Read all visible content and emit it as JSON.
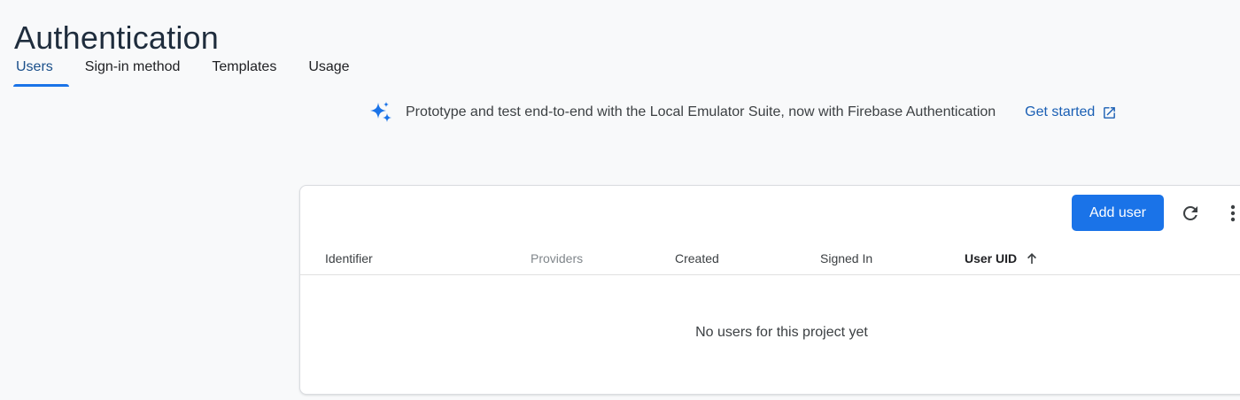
{
  "header": {
    "title": "Authentication"
  },
  "tabs": [
    {
      "label": "Users",
      "active": true
    },
    {
      "label": "Sign-in method",
      "active": false
    },
    {
      "label": "Templates",
      "active": false
    },
    {
      "label": "Usage",
      "active": false
    }
  ],
  "banner": {
    "icon": "sparkle-icon",
    "text": "Prototype and test end-to-end with the Local Emulator Suite, now with Firebase Authentication",
    "link_label": "Get started",
    "link_icon": "open-in-new-icon"
  },
  "users_table": {
    "add_user_label": "Add user",
    "refresh_icon": "refresh-icon",
    "more_icon": "more-vert-icon",
    "columns": [
      {
        "label": "Identifier",
        "style": "normal"
      },
      {
        "label": "Providers",
        "style": "muted"
      },
      {
        "label": "Created",
        "style": "normal"
      },
      {
        "label": "Signed In",
        "style": "normal"
      },
      {
        "label": "User UID",
        "style": "sorted",
        "sort": "ascending"
      }
    ],
    "empty_message": "No users for this project yet"
  },
  "colors": {
    "accent": "#1a73e8",
    "link": "#1a5fb4",
    "background": "#f8f9fa"
  }
}
